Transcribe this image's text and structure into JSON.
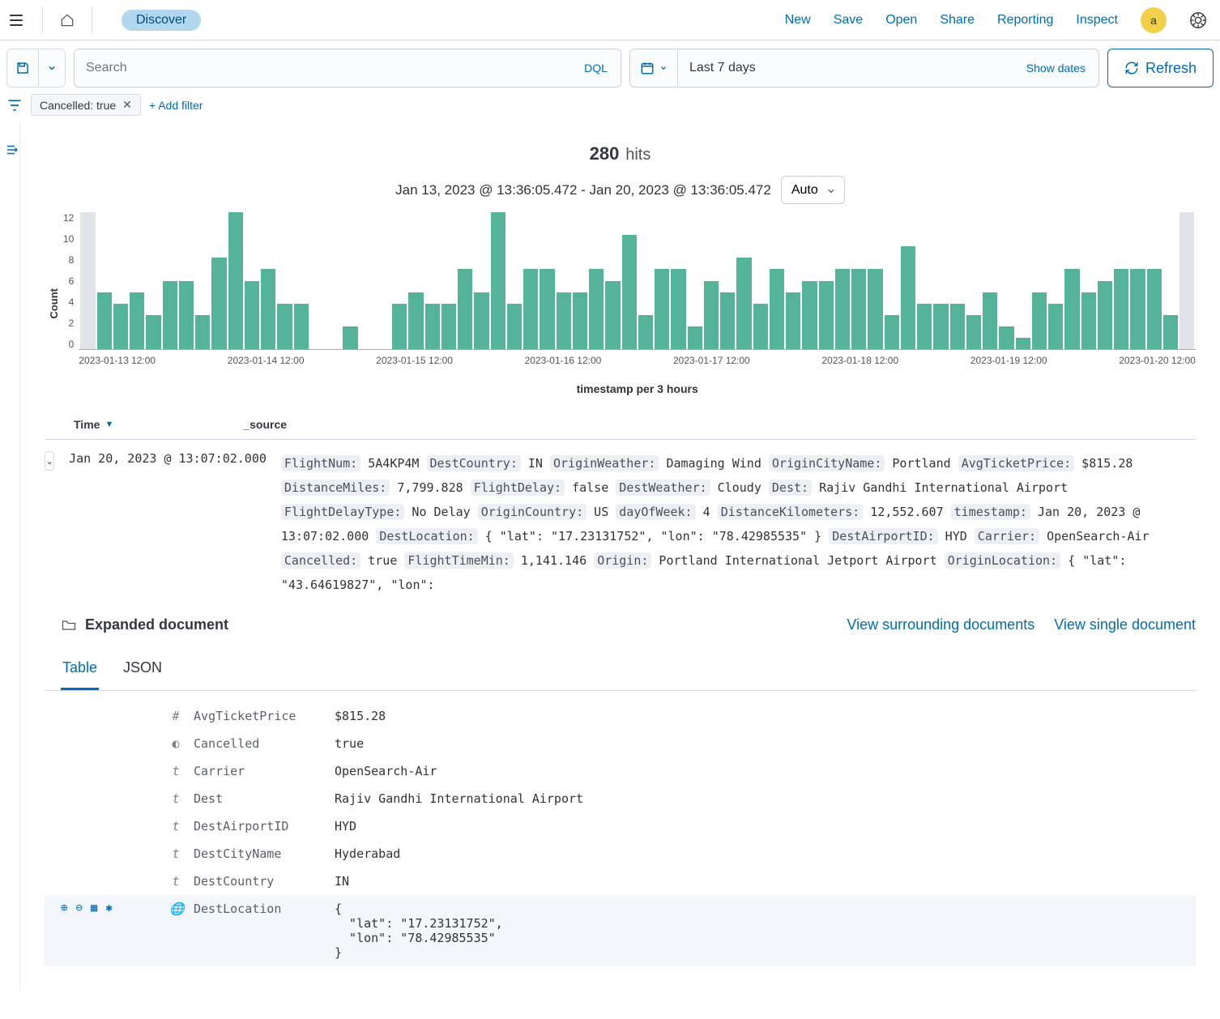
{
  "topbar": {
    "breadcrumb": "Discover",
    "links": [
      "New",
      "Save",
      "Open",
      "Share",
      "Reporting",
      "Inspect"
    ],
    "avatar": "a"
  },
  "query": {
    "search_placeholder": "Search",
    "dql_label": "DQL",
    "date_label": "Last 7 days",
    "show_dates": "Show dates",
    "refresh": "Refresh"
  },
  "filters": {
    "pill": "Cancelled: true",
    "add_filter": "+ Add filter"
  },
  "hits": {
    "count": "280",
    "label": "hits",
    "range": "Jan 13, 2023 @ 13:36:05.472 - Jan 20, 2023 @ 13:36:05.472",
    "interval": "Auto"
  },
  "chart_data": {
    "type": "bar",
    "ylabel": "Count",
    "xlabel": "timestamp per 3 hours",
    "ylim": [
      0,
      12
    ],
    "y_ticks": [
      "12",
      "10",
      "8",
      "6",
      "4",
      "2",
      "0"
    ],
    "x_ticks": [
      "2023-01-13 12:00",
      "2023-01-14 12:00",
      "2023-01-15 12:00",
      "2023-01-16 12:00",
      "2023-01-17 12:00",
      "2023-01-18 12:00",
      "2023-01-19 12:00",
      "2023-01-20 12:00"
    ],
    "values": [
      5,
      4,
      5,
      3,
      6,
      6,
      3,
      8,
      12,
      6,
      7,
      4,
      4,
      0,
      0,
      2,
      0,
      0,
      4,
      5,
      4,
      4,
      7,
      5,
      12,
      4,
      7,
      7,
      5,
      5,
      7,
      6,
      10,
      3,
      7,
      7,
      2,
      6,
      5,
      8,
      4,
      7,
      5,
      6,
      6,
      7,
      7,
      7,
      3,
      9,
      4,
      4,
      4,
      3,
      5,
      2,
      1,
      5,
      4,
      7,
      5,
      6,
      7,
      7,
      7,
      3
    ],
    "gray_start": 0,
    "gray_end": 0,
    "gray_tail": 1
  },
  "table": {
    "col_time": "Time",
    "col_source": "_source"
  },
  "row": {
    "time": "Jan 20, 2023 @ 13:07:02.000",
    "fields": [
      {
        "k": "FlightNum:",
        "v": "5A4KP4M"
      },
      {
        "k": "DestCountry:",
        "v": "IN"
      },
      {
        "k": "OriginWeather:",
        "v": "Damaging Wind"
      },
      {
        "k": "OriginCityName:",
        "v": "Portland"
      },
      {
        "k": "AvgTicketPrice:",
        "v": "$815.28"
      },
      {
        "k": "DistanceMiles:",
        "v": "7,799.828"
      },
      {
        "k": "FlightDelay:",
        "v": "false"
      },
      {
        "k": "DestWeather:",
        "v": "Cloudy"
      },
      {
        "k": "Dest:",
        "v": "Rajiv Gandhi International Airport"
      },
      {
        "k": "FlightDelayType:",
        "v": "No Delay"
      },
      {
        "k": "OriginCountry:",
        "v": "US"
      },
      {
        "k": "dayOfWeek:",
        "v": "4"
      },
      {
        "k": "DistanceKilometers:",
        "v": "12,552.607"
      },
      {
        "k": "timestamp:",
        "v": "Jan 20, 2023 @ 13:07:02.000"
      },
      {
        "k": "DestLocation:",
        "v": "{ \"lat\": \"17.23131752\", \"lon\": \"78.42985535\" }"
      },
      {
        "k": "DestAirportID:",
        "v": "HYD"
      },
      {
        "k": "Carrier:",
        "v": "OpenSearch-Air"
      },
      {
        "k": "Cancelled:",
        "v": "true"
      },
      {
        "k": "FlightTimeMin:",
        "v": "1,141.146"
      },
      {
        "k": "Origin:",
        "v": "Portland International Jetport Airport"
      },
      {
        "k": "OriginLocation:",
        "v": "{ \"lat\": \"43.64619827\", \"lon\":"
      }
    ]
  },
  "expanded": {
    "title": "Expanded document",
    "link_surrounding": "View surrounding documents",
    "link_single": "View single document",
    "tab_table": "Table",
    "tab_json": "JSON"
  },
  "doc_fields": [
    {
      "type": "#",
      "name": "AvgTicketPrice",
      "value": "$815.28"
    },
    {
      "type": "◐",
      "name": "Cancelled",
      "value": "true"
    },
    {
      "type": "t",
      "name": "Carrier",
      "value": "OpenSearch-Air"
    },
    {
      "type": "t",
      "name": "Dest",
      "value": "Rajiv Gandhi International Airport"
    },
    {
      "type": "t",
      "name": "DestAirportID",
      "value": "HYD"
    },
    {
      "type": "t",
      "name": "DestCityName",
      "value": "Hyderabad"
    },
    {
      "type": "t",
      "name": "DestCountry",
      "value": "IN"
    },
    {
      "type": "🌐",
      "name": "DestLocation",
      "value": "{\n  \"lat\": \"17.23131752\",\n  \"lon\": \"78.42985535\"\n}",
      "highlight": true
    }
  ]
}
